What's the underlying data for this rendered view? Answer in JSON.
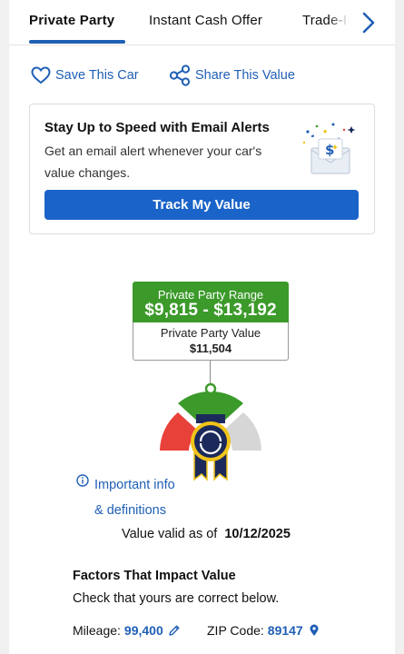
{
  "tabs": [
    {
      "label": "Private Party"
    },
    {
      "label": "Instant Cash Offer"
    },
    {
      "label": "Trade-In"
    }
  ],
  "actions": {
    "save_label": "Save This Car",
    "share_label": "Share This Value"
  },
  "alert_card": {
    "title": "Stay Up to Speed with Email Alerts",
    "description": "Get an email alert whenever your car's value changes.",
    "button_label": "Track My Value"
  },
  "price": {
    "range_title": "Private Party Range",
    "range_value": "$9,815 - $13,192",
    "value_title": "Private Party Value",
    "value_amount": "$11,504"
  },
  "info_link": {
    "line1": "Important info",
    "line2": "& definitions"
  },
  "valid": {
    "label": "Value valid as of",
    "date": "10/12/2025"
  },
  "factors": {
    "title": "Factors That Impact Value",
    "subtitle": "Check that yours are correct below.",
    "mileage_label": "Mileage:",
    "mileage_value": "99,400",
    "zip_label": "ZIP Code:",
    "zip_value": "89147"
  },
  "colors": {
    "accent": "#1f5fb5",
    "button": "#1a63c8",
    "range_green": "#3b9a2a",
    "gauge_red": "#e8413a",
    "gauge_green": "#3b9a2a",
    "gauge_gray": "#d6d6d6",
    "badge_navy": "#1b2a5a",
    "badge_gold": "#f0c419"
  },
  "icons": {
    "heart": "heart-icon",
    "share": "share-icon",
    "chevron": "chevron-right-icon",
    "info": "info-icon",
    "pencil": "pencil-icon",
    "pin": "location-pin-icon",
    "envelope": "envelope-money-icon",
    "badge": "kbb-badge-icon"
  }
}
